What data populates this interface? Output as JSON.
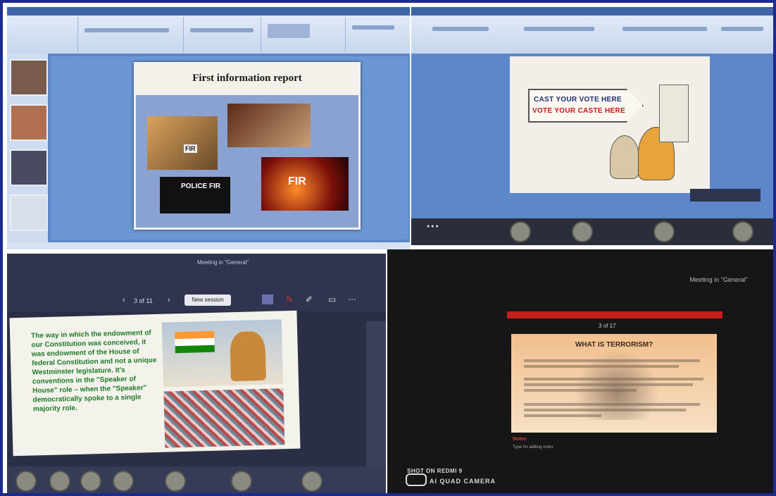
{
  "quadrants": {
    "top_left": {
      "slide_title": "First information report",
      "images": [
        "FIR",
        "POLICE FIR",
        "FIR"
      ]
    },
    "top_right": {
      "vote_line_1": "CAST YOUR VOTE HERE",
      "vote_line_2": "VOTE YOUR CASTE HERE"
    },
    "bottom_left": {
      "meeting_title": "Meeting in \"General\"",
      "pager": "3 of 11",
      "new_session_label": "New session",
      "slide_text": "The way in which the endowment of our Constitution was conceived, it was endowment of the House of federal Constitution and not a unique Westminster legislature. It's conventions in the \"Speaker of House\" role – when the \"Speaker\" democratically spoke to a single majority role."
    },
    "bottom_right": {
      "meeting_title": "Meeting in \"General\"",
      "pager": "3 of 17",
      "slide_title": "WHAT IS TERRORISM?",
      "notes_label": "Notes",
      "notes_hint": "Type for adding notes",
      "camera_label_1": "SHOT ON REDMI 9",
      "camera_label_2": "AI QUAD CAMERA"
    }
  },
  "colors": {
    "frame_border": "#1d2b8f",
    "ppt_blue": "#5f86c4",
    "teams_dark": "#2b2f45",
    "green_text": "#1e7a2a",
    "red_bar": "#c41f1f"
  }
}
